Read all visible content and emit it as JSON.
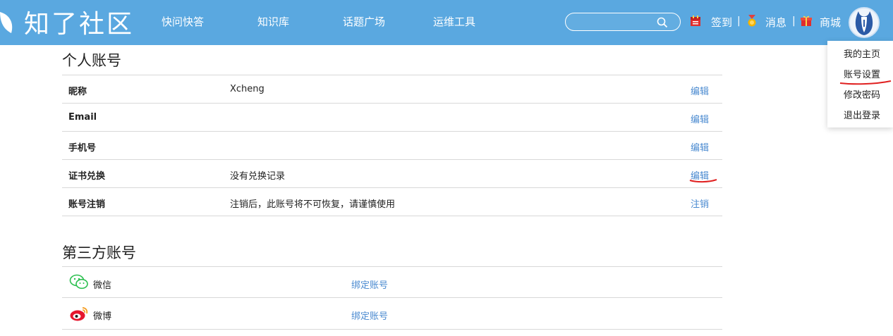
{
  "header": {
    "logo_text": "知了社区",
    "nav": [
      "快问快答",
      "知识库",
      "话题广场",
      "运维工具"
    ],
    "search": {
      "placeholder": "",
      "value": ""
    },
    "links": {
      "signin": "签到",
      "messages": "消息",
      "mall": "商城"
    },
    "separator": "|",
    "colors": {
      "bar": "#5aa8e0"
    }
  },
  "dropdown": {
    "items": [
      "我的主页",
      "账号设置",
      "修改密码",
      "退出登录"
    ]
  },
  "personal_account": {
    "title": "个人账号",
    "rows": [
      {
        "label": "昵称",
        "value": "Xcheng",
        "action": "编辑"
      },
      {
        "label": "Email",
        "value": "",
        "action": "编辑"
      },
      {
        "label": "手机号",
        "value": "",
        "action": "编辑"
      },
      {
        "label": "证书兑换",
        "value": "没有兑换记录",
        "action": "编辑"
      },
      {
        "label": "账号注销",
        "value": "注销后，此账号将不可恢复，请谨慎使用",
        "action": "注销"
      }
    ]
  },
  "third_party": {
    "title": "第三方账号",
    "rows": [
      {
        "icon": "wechat-icon",
        "name": "微信",
        "action": "绑定账号"
      },
      {
        "icon": "weibo-icon",
        "name": "微博",
        "action": "绑定账号"
      }
    ]
  },
  "annotation_color": "#e02020",
  "link_color": "#4a8ad0"
}
